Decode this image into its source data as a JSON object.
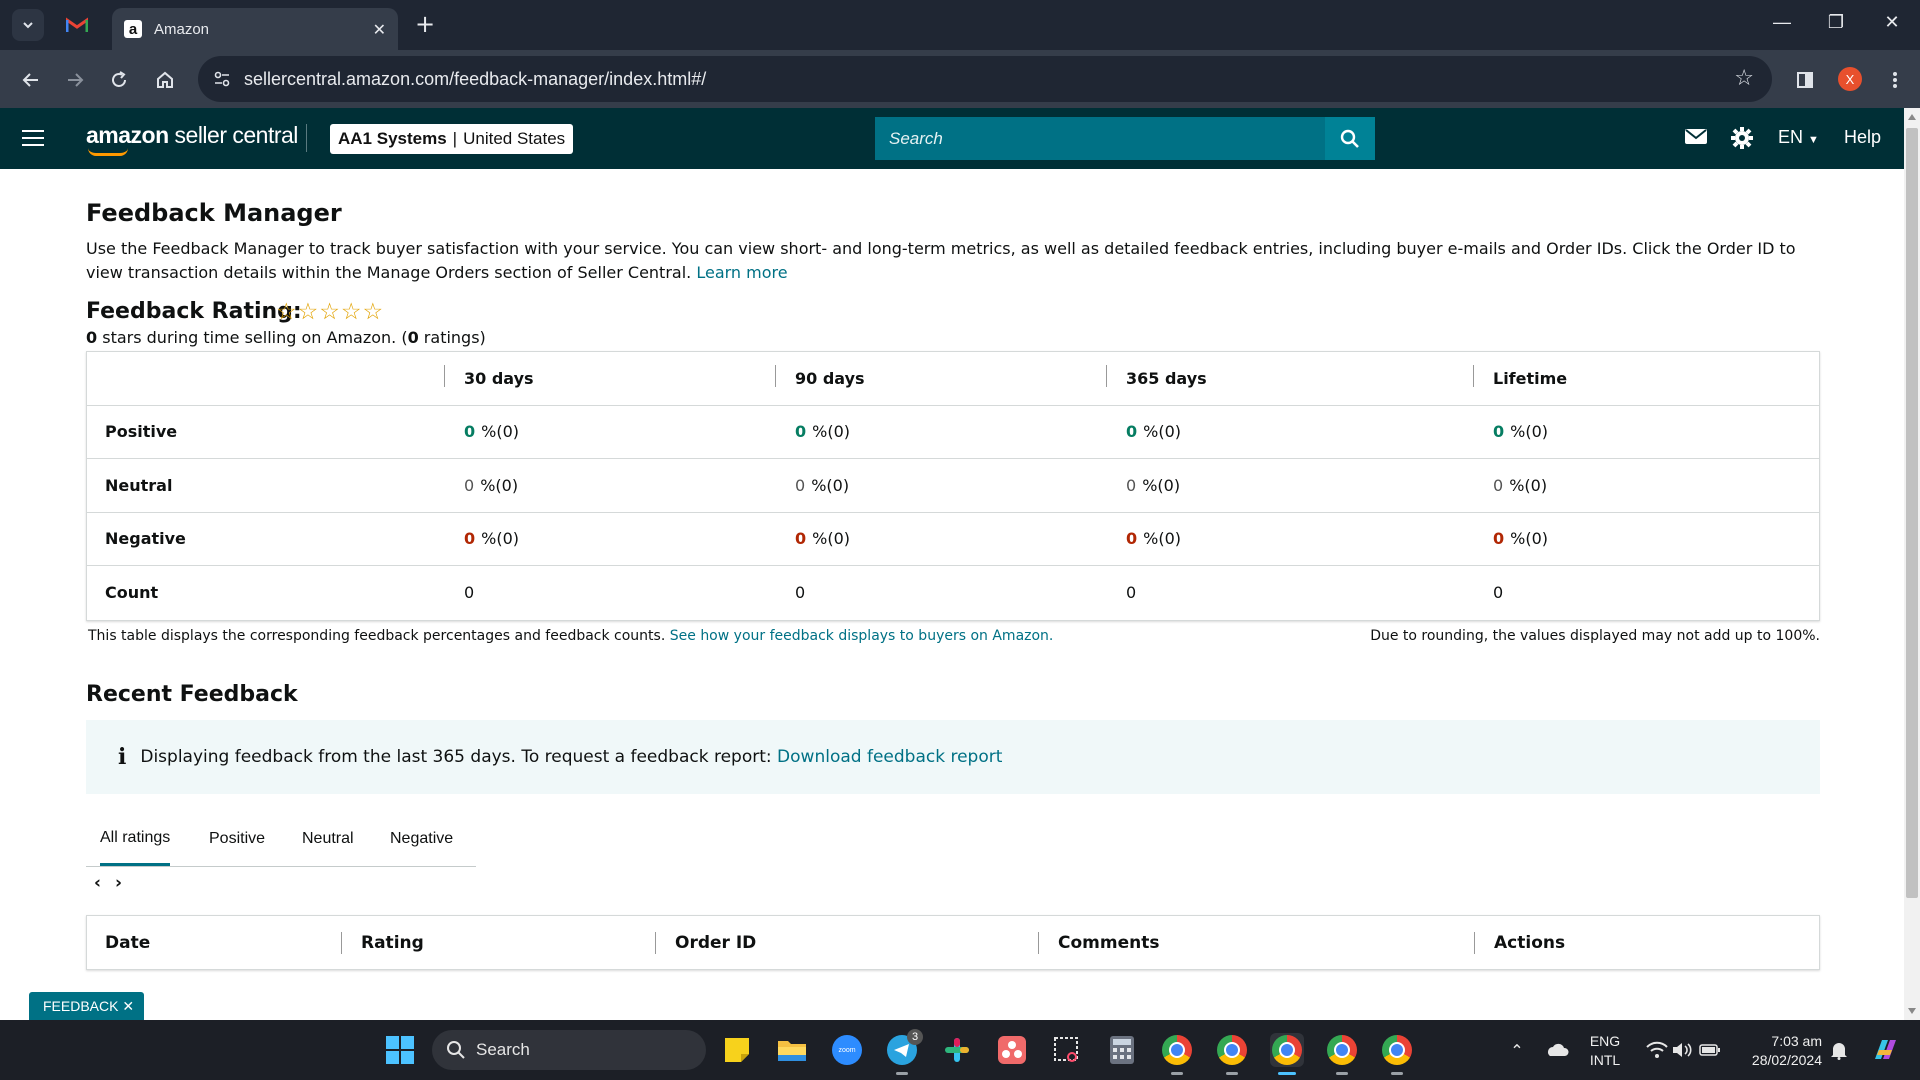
{
  "browser": {
    "tab_title": "Amazon",
    "url": "sellercentral.amazon.com/feedback-manager/index.html#/",
    "profile_initial": "X"
  },
  "header": {
    "logo_text_bold": "amazon",
    "logo_text": " seller central",
    "account_name": "AA1 Systems",
    "account_sep": "|",
    "account_region": "United States",
    "search_placeholder": "Search",
    "language": "EN",
    "help": "Help"
  },
  "page": {
    "title": "Feedback Manager",
    "intro": "Use the Feedback Manager to track buyer satisfaction with your service. You can view short- and long-term metrics, as well as detailed feedback entries, including buyer e-mails and Order IDs. Click the Order ID to view transaction details within the Manage Orders section of Seller Central.",
    "learn_more": "Learn more",
    "rating_title": "Feedback Rating:",
    "rating_stars": 0,
    "rating_sub_1": "0",
    "rating_sub_2": " stars during time selling on Amazon. (",
    "rating_sub_3": "0",
    "rating_sub_4": " ratings)"
  },
  "feedback_table": {
    "columns": [
      "30 days",
      "90 days",
      "365 days",
      "Lifetime"
    ],
    "rows": [
      {
        "label": "Positive",
        "values": [
          "0",
          "0",
          "0",
          "0"
        ],
        "suffix": "%(0)"
      },
      {
        "label": "Neutral",
        "values": [
          "0",
          "0",
          "0",
          "0"
        ],
        "suffix": "%(0)"
      },
      {
        "label": "Negative",
        "values": [
          "0",
          "0",
          "0",
          "0"
        ],
        "suffix": "%(0)"
      },
      {
        "label": "Count",
        "values": [
          "0",
          "0",
          "0",
          "0"
        ],
        "suffix": ""
      }
    ],
    "note": "This table displays the corresponding feedback percentages and feedback counts.",
    "note_link": "See how your feedback displays to buyers on Amazon.",
    "rounding_note": "Due to rounding, the values displayed may not add up to 100%."
  },
  "recent": {
    "title": "Recent Feedback",
    "info_text": "Displaying feedback from the last 365 days. To request a feedback report:",
    "info_link": "Download feedback report",
    "tabs": [
      "All ratings",
      "Positive",
      "Neutral",
      "Negative"
    ],
    "columns": [
      "Date",
      "Rating",
      "Order ID",
      "Comments",
      "Actions"
    ]
  },
  "feedback_button": "FEEDBACK",
  "taskbar": {
    "search": "Search",
    "lang_1": "ENG",
    "lang_2": "INTL",
    "time": "7:03 am",
    "date": "28/02/2024",
    "telegram_badge": "3"
  },
  "colors": {
    "header_bg": "#002f36",
    "search_bg": "#007185",
    "link": "#007185",
    "positive": "#067d62",
    "negative": "#b12704",
    "star": "#e2a200"
  }
}
